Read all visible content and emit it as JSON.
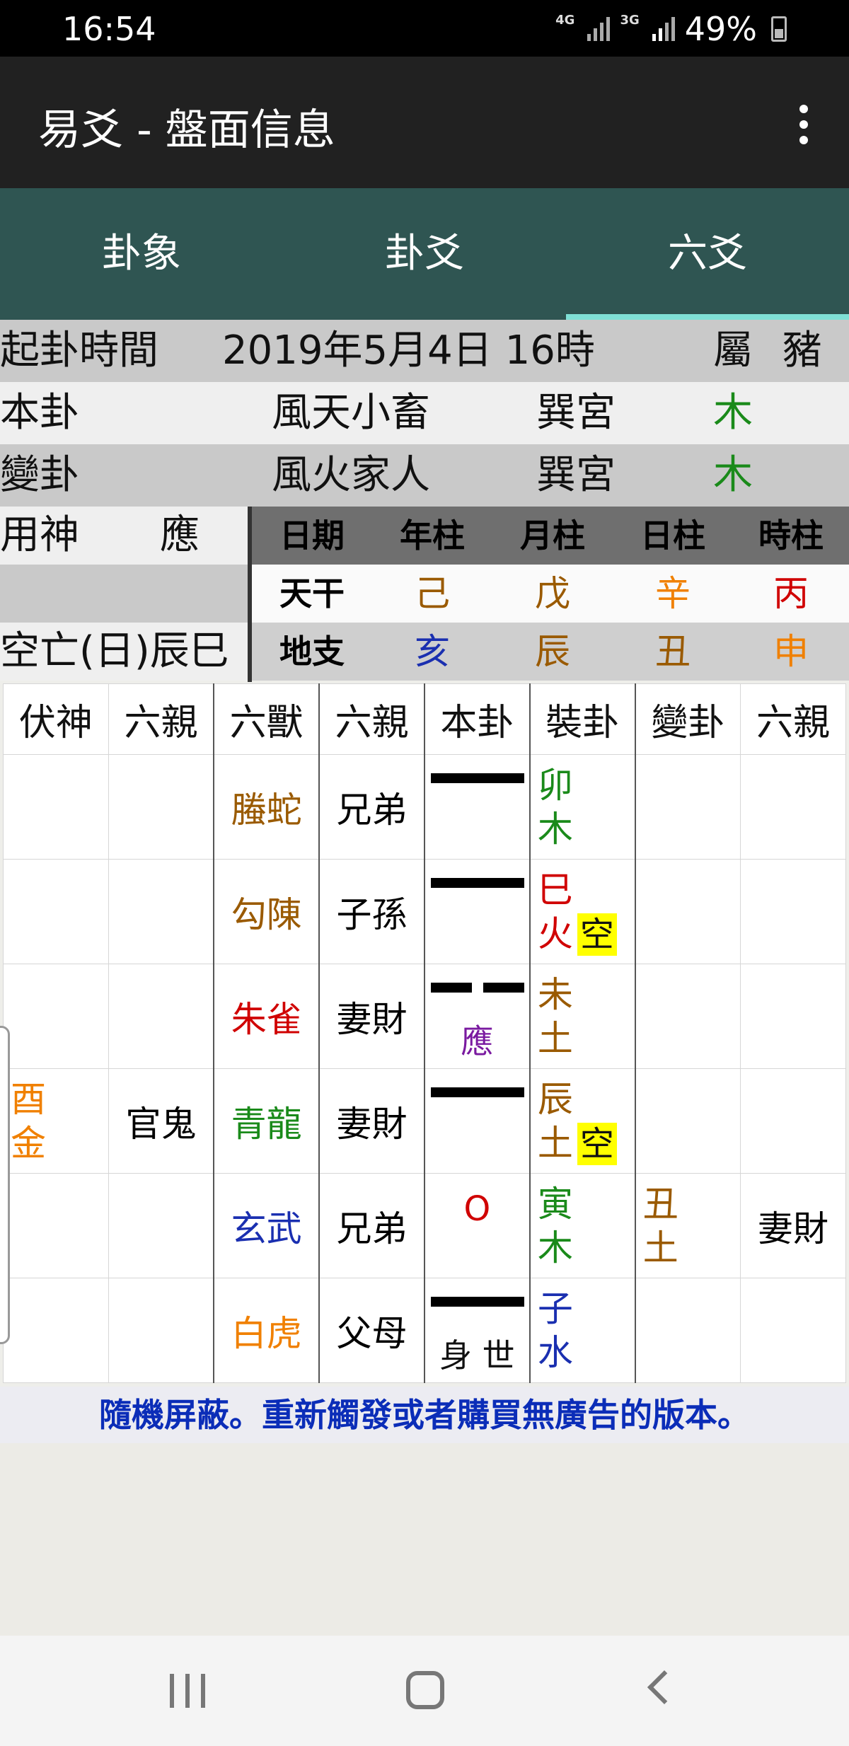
{
  "status_bar": {
    "time": "16:54",
    "network1": "4G",
    "network2": "3G",
    "battery": "49%"
  },
  "app_bar": {
    "title": "易爻 - 盤面信息"
  },
  "tabs": [
    {
      "label": "卦象"
    },
    {
      "label": "卦爻"
    },
    {
      "label": "六爻"
    }
  ],
  "info": {
    "time_label": "起卦時間",
    "time_value": "2019年5月4日 16時",
    "zodiac_label": "屬",
    "zodiac_value": "豬",
    "ben_label": "本卦",
    "ben_name": "風天小畜",
    "ben_palace": "巽宮",
    "ben_element": "木",
    "bian_label": "變卦",
    "bian_name": "風火家人",
    "bian_palace": "巽宮",
    "bian_element": "木",
    "yongshen_label": "用神",
    "yongshen_value": "應",
    "kongwang": "空亡(日)辰巳"
  },
  "ganzhi": {
    "headers": [
      "日期",
      "年柱",
      "月柱",
      "日柱",
      "時柱"
    ],
    "tiangan_label": "天干",
    "tiangan": [
      "己",
      "戊",
      "辛",
      "丙"
    ],
    "dizhi_label": "地支",
    "dizhi": [
      "亥",
      "辰",
      "丑",
      "申"
    ],
    "colors": {
      "tiangan": [
        "#9a5a00",
        "#9a5a00",
        "#f08000",
        "#d00000"
      ],
      "dizhi": [
        "#1a2fb0",
        "#9a5a00",
        "#9a5a00",
        "#f08000"
      ]
    }
  },
  "yao_table": {
    "headers": [
      "伏神",
      "六親",
      "六獸",
      "六親",
      "本卦",
      "裝卦",
      "變卦",
      "六親"
    ],
    "rows": [
      {
        "fushen": [
          "",
          ""
        ],
        "fu_liuqin": "",
        "shou": "螣蛇",
        "shou_color": "#9a5a00",
        "liuqin": "兄弟",
        "line": "yang",
        "mark": "",
        "zhuang": [
          "卯",
          "木"
        ],
        "zhuang_color": "#1a8a1a",
        "kong": "",
        "bian": [
          "",
          ""
        ],
        "bian_liuqin": ""
      },
      {
        "fushen": [
          "",
          ""
        ],
        "fu_liuqin": "",
        "shou": "勾陳",
        "shou_color": "#9a5a00",
        "liuqin": "子孫",
        "line": "yang",
        "mark": "",
        "zhuang": [
          "巳",
          "火"
        ],
        "zhuang_color": "#d00000",
        "kong": "空",
        "bian": [
          "",
          ""
        ],
        "bian_liuqin": ""
      },
      {
        "fushen": [
          "",
          ""
        ],
        "fu_liuqin": "",
        "shou": "朱雀",
        "shou_color": "#d00000",
        "liuqin": "妻財",
        "line": "yin",
        "mark": "應",
        "zhuang": [
          "未",
          "土"
        ],
        "zhuang_color": "#9a5a00",
        "kong": "",
        "bian": [
          "",
          ""
        ],
        "bian_liuqin": ""
      },
      {
        "fushen": [
          "酉",
          "金"
        ],
        "fu_liuqin": "官鬼",
        "shou": "青龍",
        "shou_color": "#1a8a1a",
        "liuqin": "妻財",
        "line": "yang",
        "mark": "",
        "zhuang": [
          "辰",
          "土"
        ],
        "zhuang_color": "#9a5a00",
        "kong": "空",
        "bian": [
          "",
          ""
        ],
        "bian_liuqin": ""
      },
      {
        "fushen": [
          "",
          ""
        ],
        "fu_liuqin": "",
        "shou": "玄武",
        "shou_color": "#1a2fb0",
        "liuqin": "兄弟",
        "line": "moving",
        "moving_mark": "O",
        "mark": "",
        "zhuang": [
          "寅",
          "木"
        ],
        "zhuang_color": "#1a8a1a",
        "kong": "",
        "bian": [
          "丑",
          "土"
        ],
        "bian_liuqin": "妻財"
      },
      {
        "fushen": [
          "",
          ""
        ],
        "fu_liuqin": "",
        "shou": "白虎",
        "shou_color": "#f08000",
        "liuqin": "父母",
        "line": "yang",
        "mark": "身 世",
        "zhuang": [
          "子",
          "水"
        ],
        "zhuang_color": "#1a2fb0",
        "kong": "",
        "bian": [
          "",
          ""
        ],
        "bian_liuqin": ""
      }
    ]
  },
  "ad_text": "隨機屏蔽。重新觸發或者購買無廣告的版本。",
  "colors": {
    "appbar": "#212121",
    "tabs": "#2f5552",
    "tab_indicator": "#7fe0d6",
    "green": "#1a8a1a",
    "ad_text": "#0b2db8",
    "kong_bg": "#ffff00"
  }
}
